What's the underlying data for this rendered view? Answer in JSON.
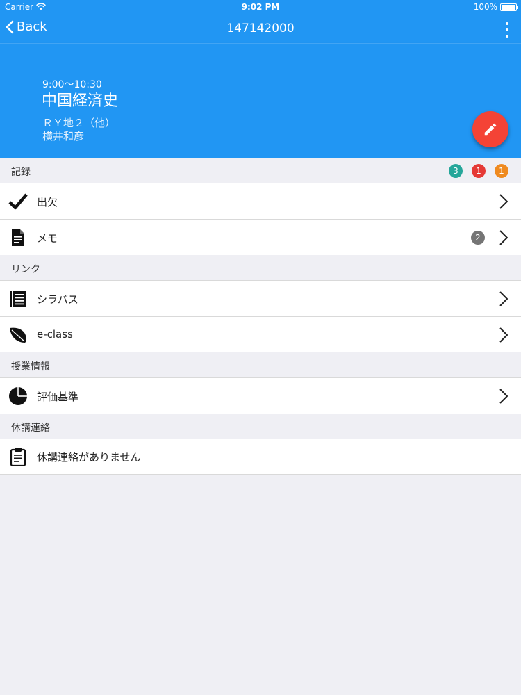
{
  "status_bar": {
    "carrier": "Carrier",
    "time": "9:02 PM",
    "battery": "100%"
  },
  "nav": {
    "back_label": "Back",
    "title": "147142000"
  },
  "header": {
    "time_range": "9:00〜10:30",
    "course_name": "中国経済史",
    "room": "ＲＹ地２（他）",
    "teacher": "横井和彦",
    "accent_color": "#2196f3"
  },
  "fab": {
    "icon": "pencil-icon",
    "color": "#f44336"
  },
  "sections": {
    "record": {
      "label": "記録",
      "badges": [
        {
          "value": "3",
          "color": "#26a69a"
        },
        {
          "value": "1",
          "color": "#e53935"
        },
        {
          "value": "1",
          "color": "#ef8a1f"
        }
      ],
      "items": [
        {
          "label": "出欠",
          "icon": "checkmark-icon"
        },
        {
          "label": "メモ",
          "icon": "document-icon",
          "count": "2"
        }
      ]
    },
    "links": {
      "label": "リンク",
      "items": [
        {
          "label": "シラバス",
          "icon": "list-icon"
        },
        {
          "label": "e-class",
          "icon": "leaf-icon"
        }
      ]
    },
    "class_info": {
      "label": "授業情報",
      "items": [
        {
          "label": "評価基準",
          "icon": "pie-chart-icon"
        }
      ]
    },
    "cancellation": {
      "label": "休講連絡",
      "items": [
        {
          "label": "休講連絡がありません",
          "icon": "clipboard-icon"
        }
      ]
    }
  }
}
